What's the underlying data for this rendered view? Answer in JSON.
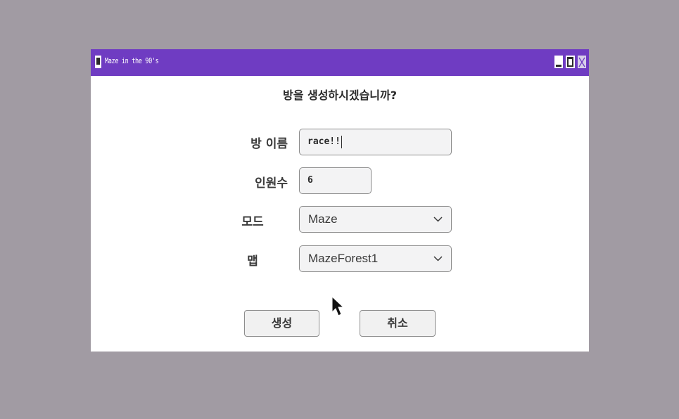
{
  "window": {
    "title": "Maze in the 90's",
    "accent_color": "#6f3cc2",
    "background_color": "#a19ba3"
  },
  "dialog": {
    "question": "방을 생성하시겠습니까?",
    "room_name": {
      "label": "방 이름",
      "value": "race!!"
    },
    "players": {
      "label": "인원수",
      "value": "6"
    },
    "mode": {
      "label": "모드",
      "selected": "Maze"
    },
    "map": {
      "label": "맵",
      "selected": "MazeForest1"
    },
    "buttons": {
      "create": "생성",
      "cancel": "취소"
    }
  },
  "icons": {
    "app": "app-icon",
    "minimize": "minimize-icon",
    "maximize": "maximize-icon",
    "close": "close-icon",
    "dropdown": "chevron-down-icon",
    "pointer": "mouse-pointer-icon"
  }
}
